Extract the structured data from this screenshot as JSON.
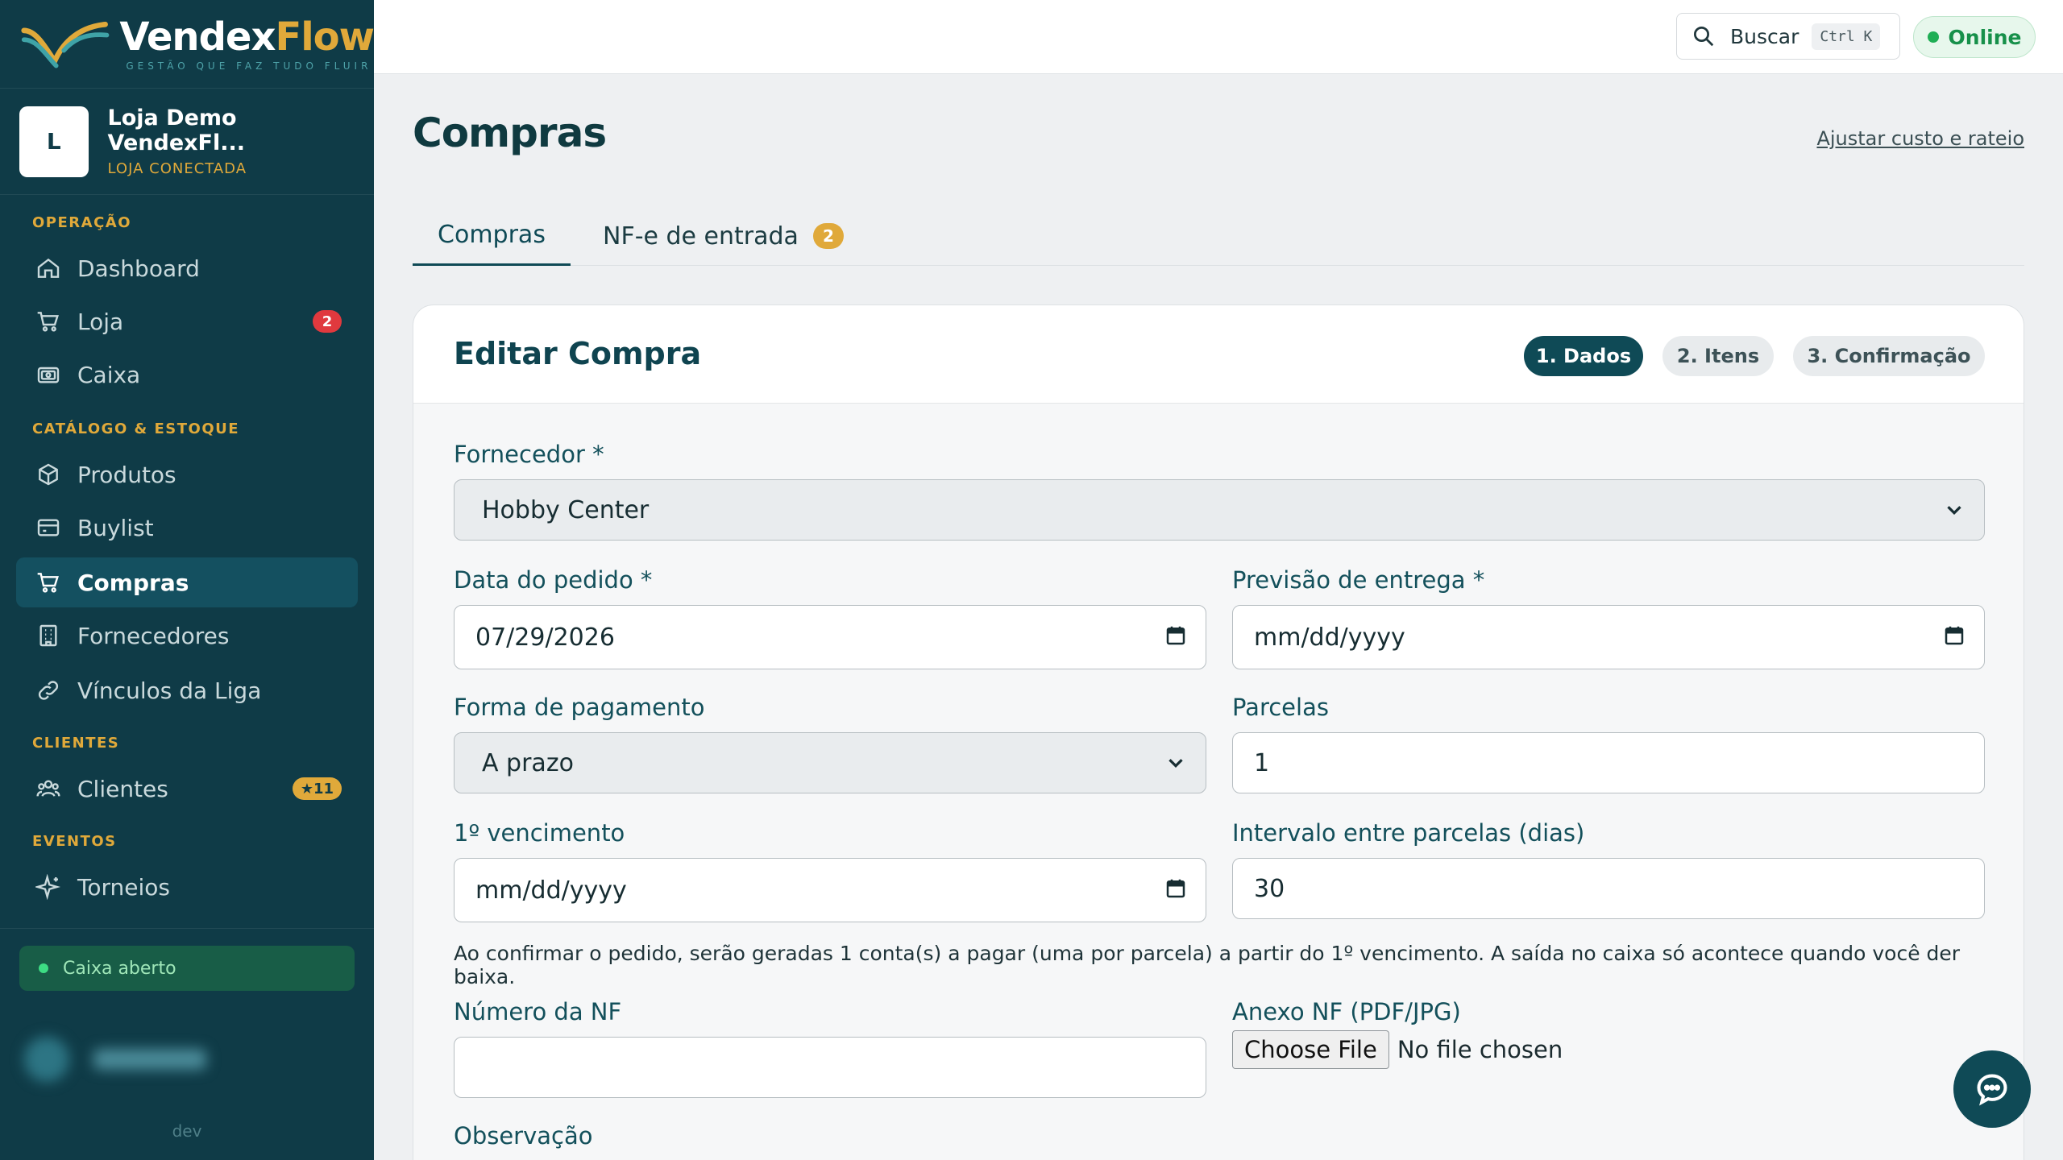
{
  "brand": {
    "name_part1": "Vendex",
    "name_part2": "Flow",
    "tagline": "GESTÃO QUE FAZ TUDO FLUIR"
  },
  "store": {
    "initial": "L",
    "name": "Loja Demo VendexFl...",
    "status": "LOJA CONECTADA"
  },
  "sidebar": {
    "sections": {
      "operacao": "OPERAÇÃO",
      "catalogo": "CATÁLOGO & ESTOQUE",
      "clientes": "CLIENTES",
      "eventos": "EVENTOS"
    },
    "items": [
      {
        "label": "Dashboard",
        "icon": "home-icon"
      },
      {
        "label": "Loja",
        "icon": "cart-icon",
        "badge": "2"
      },
      {
        "label": "Caixa",
        "icon": "cash-icon"
      },
      {
        "label": "Produtos",
        "icon": "box-icon"
      },
      {
        "label": "Buylist",
        "icon": "card-icon"
      },
      {
        "label": "Compras",
        "icon": "cart-icon",
        "active": true
      },
      {
        "label": "Fornecedores",
        "icon": "building-icon"
      },
      {
        "label": "Vínculos da Liga",
        "icon": "link-icon"
      },
      {
        "label": "Clientes",
        "icon": "users-icon",
        "badge": "★11"
      },
      {
        "label": "Torneios",
        "icon": "sparkle-icon"
      }
    ],
    "cash_status": "Caixa aberto",
    "env": "dev"
  },
  "topbar": {
    "search_label": "Buscar",
    "search_shortcut": "Ctrl K",
    "status": "Online"
  },
  "page": {
    "title": "Compras",
    "adjust_link": "Ajustar custo e rateio"
  },
  "tabs": [
    {
      "label": "Compras",
      "active": true
    },
    {
      "label": "NF-e de entrada",
      "count": "2"
    }
  ],
  "form": {
    "title": "Editar Compra",
    "steps": [
      "1. Dados",
      "2. Itens",
      "3. Confirmação"
    ],
    "fornecedor": {
      "label": "Fornecedor *",
      "value": "Hobby Center"
    },
    "data_pedido": {
      "label": "Data do pedido *",
      "value": "07/29/2026"
    },
    "previsao": {
      "label": "Previsão de entrega *",
      "value": "mm/dd/yyyy"
    },
    "forma_pagamento": {
      "label": "Forma de pagamento",
      "value": "A prazo"
    },
    "parcelas": {
      "label": "Parcelas",
      "value": "1"
    },
    "vencimento": {
      "label": "1º vencimento",
      "value": "mm/dd/yyyy"
    },
    "intervalo": {
      "label": "Intervalo entre parcelas (dias)",
      "value": "30"
    },
    "note": "Ao confirmar o pedido, serão geradas 1 conta(s) a pagar (uma por parcela) a partir do 1º vencimento. A saída no caixa só acontece quando você der baixa.",
    "numero_nf": {
      "label": "Número da NF",
      "value": ""
    },
    "anexo_nf": {
      "label": "Anexo NF (PDF/JPG)",
      "button": "Choose File",
      "status": "No file chosen"
    },
    "observacao": {
      "label": "Observação"
    }
  },
  "colors": {
    "sidebar": "#0f3b47",
    "accent": "#e0a93a",
    "primary": "#0f4a56",
    "online": "#1fae55"
  }
}
